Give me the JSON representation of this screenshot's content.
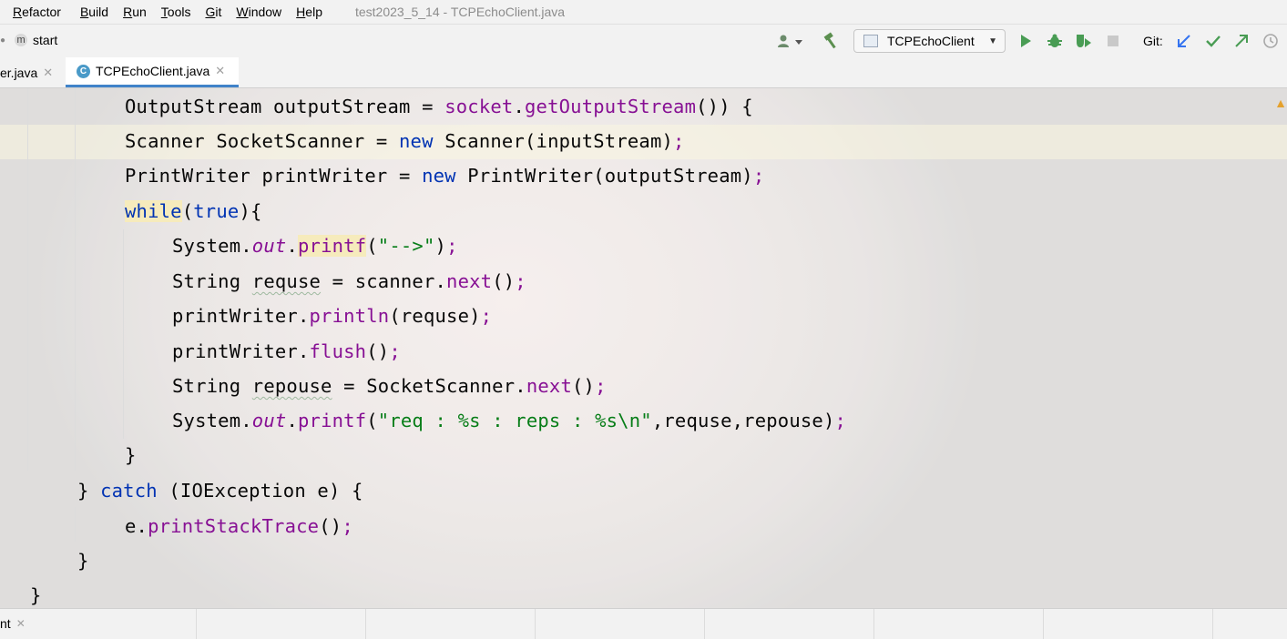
{
  "menu": {
    "items": [
      {
        "label": "Refactor",
        "mnemonic": "R"
      },
      {
        "label": "Build",
        "mnemonic": "B"
      },
      {
        "label": "Run",
        "mnemonic": "R"
      },
      {
        "label": "Tools",
        "mnemonic": "T"
      },
      {
        "label": "Git",
        "mnemonic": "G"
      },
      {
        "label": "Window",
        "mnemonic": "W"
      },
      {
        "label": "Help",
        "mnemonic": "H"
      }
    ],
    "window_title": "test2023_5_14 - TCPEchoClient.java"
  },
  "nav": {
    "breadcrumb_icon_letter": "m",
    "breadcrumb_label": "start",
    "run_config": "TCPEchoClient",
    "git_label": "Git:"
  },
  "tabs": [
    {
      "label": "er.java",
      "active": false
    },
    {
      "label": "TCPEchoClient.java",
      "active": true
    }
  ],
  "colors": {
    "keyword": "#0033b3",
    "method": "#871094",
    "string": "#067d17",
    "run_green": "#499c54",
    "git_blue": "#3574f0"
  },
  "code": {
    "l1": [
      "OutputStream outputStream = ",
      "socket",
      ".",
      "getOutputStream",
      "()) {"
    ],
    "l2": [
      "Scanner SocketScanner = ",
      "new",
      " Scanner(inputStream)",
      ";"
    ],
    "l3": [
      "PrintWriter printWriter = ",
      "new",
      " PrintWriter(outputStream)",
      ";"
    ],
    "l4": [
      "while",
      "(",
      "true",
      "){"
    ],
    "l5": [
      "System.",
      "out",
      ".",
      "printf",
      "(",
      "\"-->\"",
      ")",
      ";"
    ],
    "l6": [
      "String ",
      "requse",
      " = scanner.",
      "next",
      "()",
      ";"
    ],
    "l7": [
      "printWriter.",
      "println",
      "(requse)",
      ";"
    ],
    "l8": [
      "printWriter.",
      "flush",
      "()",
      ";"
    ],
    "l9": [
      "String ",
      "repouse",
      " = SocketScanner.",
      "next",
      "()",
      ";"
    ],
    "l10": [
      "System.",
      "out",
      ".",
      "printf",
      "(",
      "\"req : %s : reps : %s\\n\"",
      ",requse,repouse)",
      ";"
    ],
    "l11": [
      "}"
    ],
    "l12": [
      "} ",
      "catch",
      " (IOException e) {"
    ],
    "l13": [
      "e.",
      "printStackTrace",
      "()",
      ";"
    ],
    "l14": [
      "}"
    ],
    "l15": [
      "}"
    ]
  },
  "bottom": {
    "tab_label": "nt"
  }
}
